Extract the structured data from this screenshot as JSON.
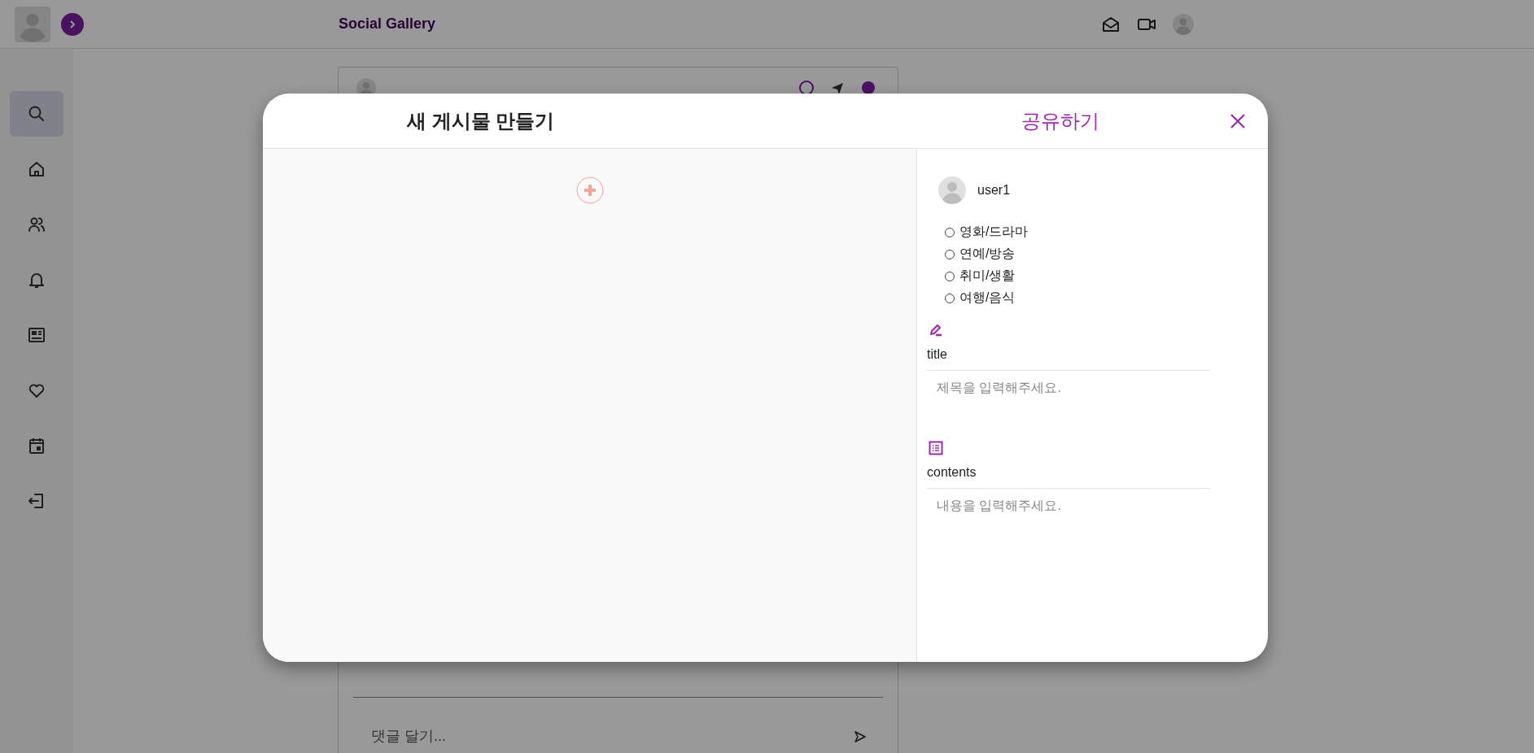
{
  "topbar": {
    "title": "Social Gallery"
  },
  "sidebar": {
    "items": [
      {
        "kind": "search",
        "selected": true
      },
      {
        "kind": "home",
        "selected": false
      },
      {
        "kind": "people",
        "selected": false
      },
      {
        "kind": "bell",
        "selected": false
      },
      {
        "kind": "news",
        "selected": false
      },
      {
        "kind": "heart",
        "selected": false
      },
      {
        "kind": "calendar",
        "selected": false
      },
      {
        "kind": "logout",
        "selected": false
      }
    ]
  },
  "post_card": {
    "comment": {
      "placeholder": "댓글 달기..."
    }
  },
  "modal": {
    "title": "새 게시물 만들기",
    "share": "공유하기",
    "user": "user1",
    "categories": [
      {
        "label": "영화/드라마",
        "selected": false
      },
      {
        "label": "연예/방송",
        "selected": false
      },
      {
        "label": "취미/생활",
        "selected": false
      },
      {
        "label": "여행/음식",
        "selected": false
      }
    ],
    "fields": [
      {
        "kind": "title",
        "label": "title",
        "placeholder": "제목을 입력해주세요."
      },
      {
        "kind": "contents",
        "label": "contents",
        "placeholder": "내용을 입력해주세요."
      }
    ]
  }
}
